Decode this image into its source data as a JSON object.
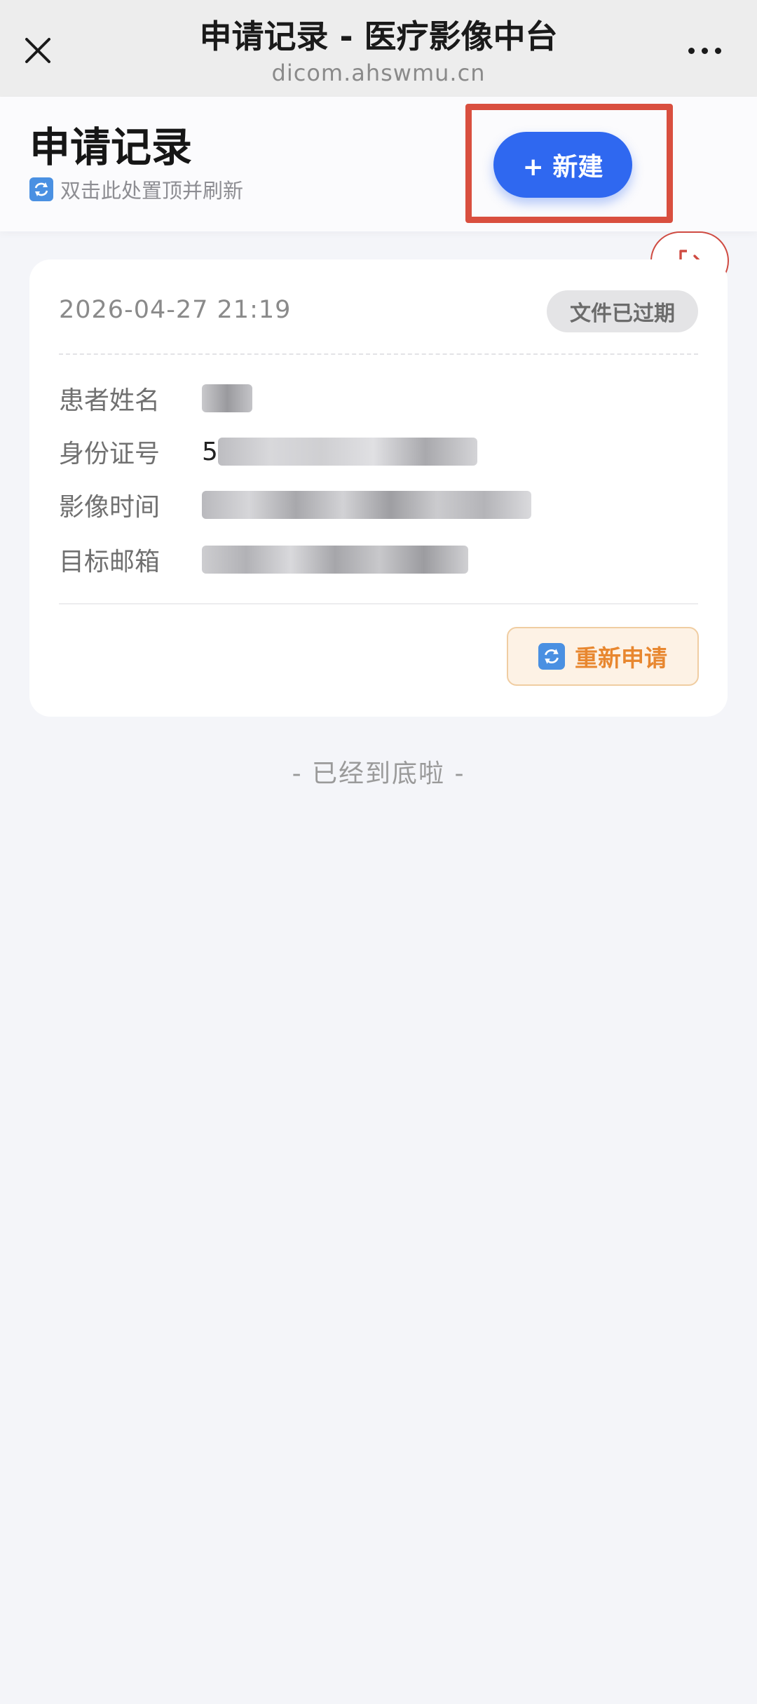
{
  "topbar": {
    "title": "申请记录 - 医疗影像中台",
    "domain": "dicom.ahswmu.cn",
    "close_icon": "close-icon",
    "more_icon": "more-dots-icon"
  },
  "header": {
    "title": "申请记录",
    "refresh_hint": "双击此处置顶并刷新",
    "refresh_icon": "refresh-icon",
    "new_button": "+ 新建",
    "logout_icon": "logout-icon"
  },
  "record": {
    "datetime": "2026-04-27 21:19",
    "status": "文件已过期",
    "fields": [
      {
        "label": "患者姓名",
        "value": ""
      },
      {
        "label": "身份证号",
        "value": "5"
      },
      {
        "label": "影像时间",
        "value": ""
      },
      {
        "label": "目标邮箱",
        "value": ""
      }
    ],
    "reapply_button": "重新申请"
  },
  "footer": {
    "end_text": "- 已经到底啦 -"
  },
  "colors": {
    "primary": "#2f68f0",
    "danger": "#d94f3f",
    "warning_text": "#e8872f",
    "background": "#f4f5f9"
  }
}
